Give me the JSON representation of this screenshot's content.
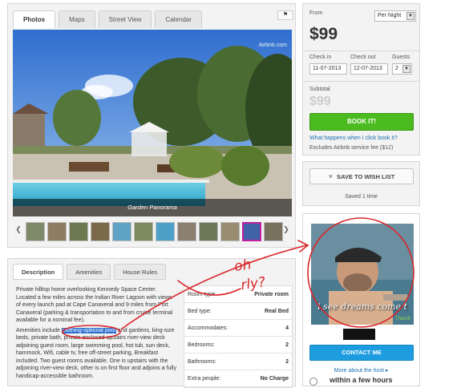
{
  "photo_tabs": [
    "Photos",
    "Maps",
    "Street View",
    "Calendar"
  ],
  "flag_icon": "flag-icon",
  "photo": {
    "watermark": "Airbnb.com",
    "caption": "Garden Panorama"
  },
  "thumbnails": {
    "count": 12,
    "selected_index": 10
  },
  "desc_tabs": [
    "Description",
    "Amenities",
    "House Rules"
  ],
  "description": {
    "p1": "Private hilltop home overlooking Kennedy Space Center. Located a few miles across the Indian River Lagoon with views of every launch pad at Cape Canaveral and 9 miles from Port Canaveral (parking & transportation to and from cruise terminal available for a nominal fee).",
    "p2_before": "Amenities include ",
    "p2_highlight": "clothing-optional pool",
    "p2_after": " and gardens, king-size beds, private bath, private enclosed upstairs river-view deck adjoining guest room, large swimming pool, hot tub, sun deck, hammock, Wifi, cable tv, free off-street parking, Breakfast included. Two guest rooms available. One is upstairs with the adjoining river-view deck, other is on first floor and adjoins a fully handicap-accessible bathroom."
  },
  "room_details": [
    {
      "label": "Room type:",
      "value": "Private room"
    },
    {
      "label": "Bed type:",
      "value": "Real Bed"
    },
    {
      "label": "Accommodates:",
      "value": "4"
    },
    {
      "label": "Bedrooms:",
      "value": "2"
    },
    {
      "label": "Bathrooms:",
      "value": "2"
    },
    {
      "label": "Extra people:",
      "value": "No Charge"
    }
  ],
  "booking": {
    "from_label": "From",
    "per_night": "Per Night",
    "price": "$99",
    "checkin_label": "Check in",
    "checkout_label": "Check out",
    "guests_label": "Guests",
    "checkin": "11-07-2013",
    "checkout": "12-07-2013",
    "guests": "2",
    "subtotal_label": "Subtotal",
    "subtotal": "$99",
    "book_button": "BOOK IT!",
    "what_link": "What happens when I click book it?",
    "fee_note": "Excludes Airbnb service fee ($12)"
  },
  "wishlist": {
    "button": "SAVE TO WISH LIST",
    "saved": "Saved 1 time"
  },
  "host": {
    "caption": "i see dreams come t",
    "sub_caption": "Theorb",
    "contact_button": "CONTACT ME",
    "more_link": "More about the host ▸",
    "response": "within a few hours"
  },
  "annotation": {
    "text1": "oh",
    "text2": "rly?",
    "color": "#d8262a"
  }
}
